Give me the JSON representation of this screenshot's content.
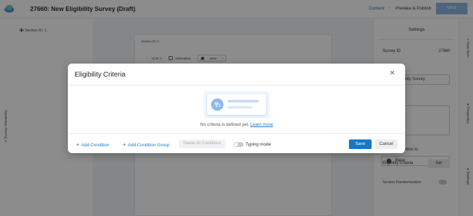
{
  "header": {
    "title": "27660: New Eligibility Survey (Draft)",
    "nav_content": "Content",
    "nav_preview": "Preview & Publish",
    "save_label": "SAVE"
  },
  "left_panel": {
    "section_id": "➕ Section ID: 1",
    "hierarchy_label": "≡ Survey Hierarchy"
  },
  "canvas": {
    "section_label": "Section ID: 1",
    "question_id": "Q ID: 1",
    "question_type": "Information",
    "question_base": "Base"
  },
  "right_panel": {
    "title": "Settings",
    "survey_id_label": "Survey ID",
    "survey_id_value": "27660",
    "survey_name_value": "ility Survey",
    "base_partial_label": "ation to",
    "base_value": "Base",
    "eligibility_label": "Eligibility Criteria",
    "eligibility_set": "Set",
    "section_randomization": "Section Randomization"
  },
  "side_tabs": {
    "new_item": "+ New Item",
    "properties": "● Properties",
    "settings": "● Settings"
  },
  "modal": {
    "title": "Eligibility Criteria",
    "empty_text": "No criteria is defined yet.",
    "learn_more": "Learn more",
    "add_condition": "Add Condition",
    "add_condition_group": "Add Condition Group",
    "delete_all": "Delete All Conditions",
    "typing_mode": "Typing mode",
    "save": "Save",
    "cancel": "Cancel"
  },
  "colors": {
    "accent": "#1677c9",
    "overlay": "#000000"
  }
}
